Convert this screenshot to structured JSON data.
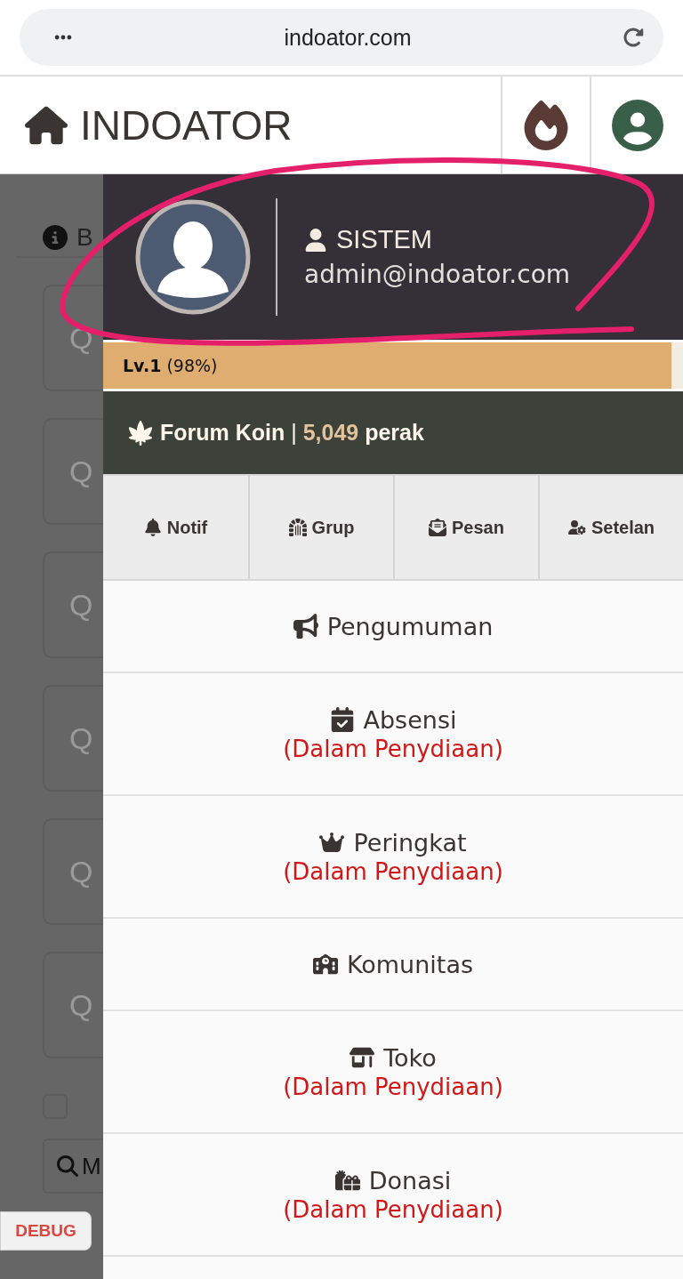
{
  "browser": {
    "url": "indoator.com"
  },
  "header": {
    "title": "INDOATOR"
  },
  "background_page": {
    "info_text": "B",
    "cards": [
      "Q",
      "Q",
      "Q",
      "Q",
      "Q",
      "Q"
    ],
    "checkbox": {
      "checked": false
    },
    "search_button": "M",
    "debug_button": "DEBUG"
  },
  "drawer": {
    "profile": {
      "name": "SISTEM",
      "email": "admin@indoator.com"
    },
    "level": {
      "label": "Lv.1",
      "percent": "(98%)",
      "level": 0.98
    },
    "coins": {
      "label": "Forum Koin",
      "separator": "|",
      "amount": "5,049",
      "unit": "perak"
    },
    "tabs": [
      {
        "label": "Notif",
        "kind": "bell"
      },
      {
        "label": "Grup",
        "kind": "gate"
      },
      {
        "label": "Pesan",
        "kind": "message"
      },
      {
        "label": "Setelan",
        "kind": "settings"
      }
    ],
    "menu": [
      {
        "label": "Pengumuman",
        "kind": "announce"
      },
      {
        "label": "Absensi",
        "kind": "calendar",
        "status": "(Dalam Penydiaan)"
      },
      {
        "label": "Peringkat",
        "kind": "crown",
        "status": "(Dalam Penydiaan)"
      },
      {
        "label": "Komunitas",
        "kind": "community"
      },
      {
        "label": "Toko",
        "kind": "shop",
        "status": "(Dalam Penydiaan)"
      },
      {
        "label": "Donasi",
        "kind": "gifts",
        "status": "(Dalam Penydiaan)"
      }
    ]
  }
}
